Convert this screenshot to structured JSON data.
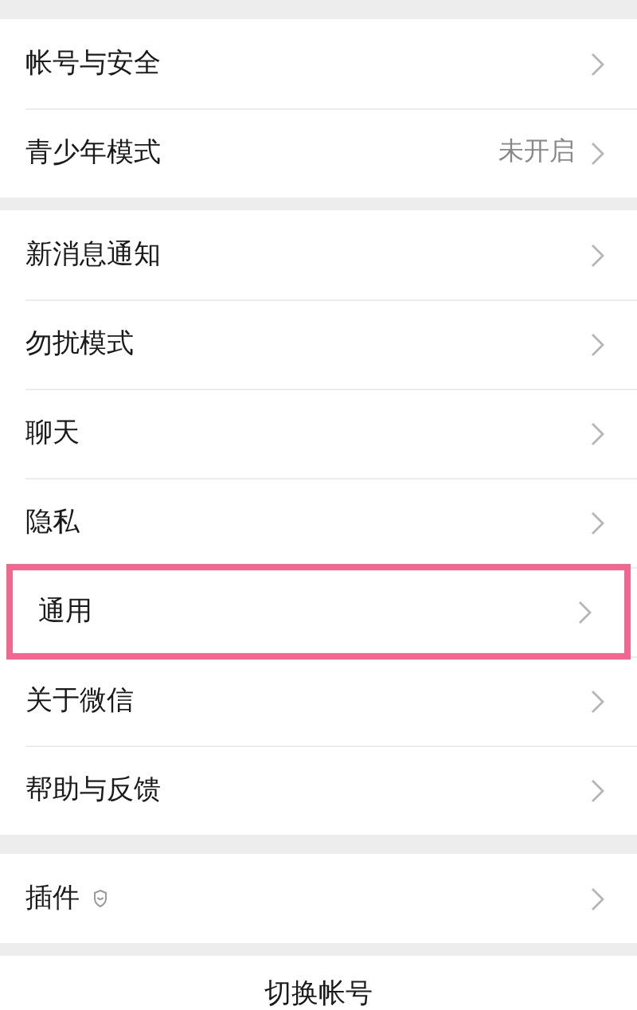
{
  "groups": [
    {
      "items": [
        {
          "label": "帐号与安全",
          "highlighted": false
        },
        {
          "label": "青少年模式",
          "value": "未开启",
          "highlighted": false
        }
      ]
    },
    {
      "items": [
        {
          "label": "新消息通知",
          "highlighted": false
        },
        {
          "label": "勿扰模式",
          "highlighted": false
        },
        {
          "label": "聊天",
          "highlighted": false
        },
        {
          "label": "隐私",
          "highlighted": false
        },
        {
          "label": "通用",
          "highlighted": true
        },
        {
          "label": "关于微信",
          "highlighted": false
        },
        {
          "label": "帮助与反馈",
          "highlighted": false
        }
      ]
    },
    {
      "items": [
        {
          "label": "插件",
          "kind": "shield",
          "highlighted": false
        }
      ]
    }
  ],
  "switch_account": "切换帐号"
}
